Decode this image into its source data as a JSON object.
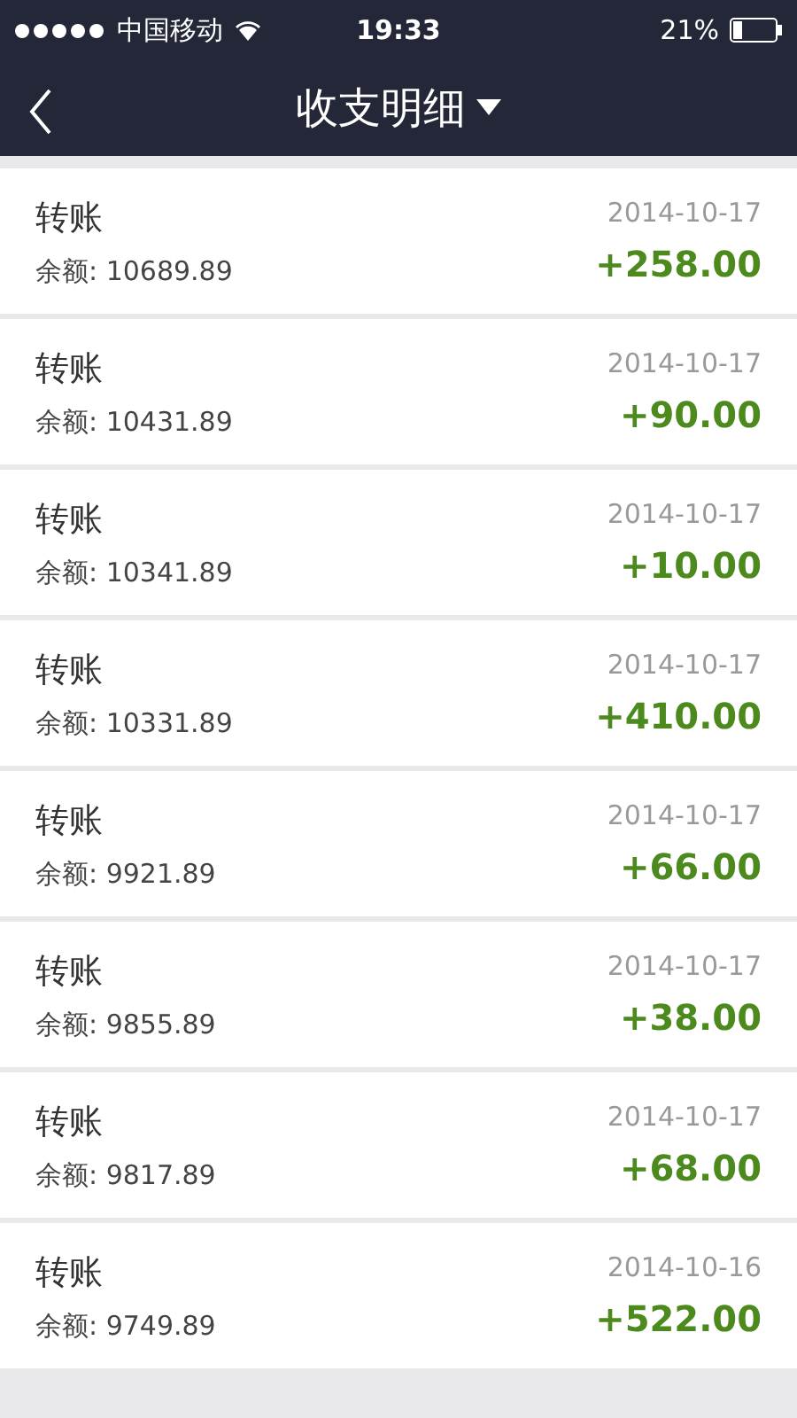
{
  "status_bar": {
    "carrier": "中国移动",
    "time": "19:33",
    "battery": "21%"
  },
  "nav": {
    "title": "收支明细"
  },
  "rows": [
    {
      "title": "转账",
      "balance": "余额: 10689.89",
      "date": "2014-10-17",
      "amount": "+258.00"
    },
    {
      "title": "转账",
      "balance": "余额: 10431.89",
      "date": "2014-10-17",
      "amount": "+90.00"
    },
    {
      "title": "转账",
      "balance": "余额: 10341.89",
      "date": "2014-10-17",
      "amount": "+10.00"
    },
    {
      "title": "转账",
      "balance": "余额: 10331.89",
      "date": "2014-10-17",
      "amount": "+410.00"
    },
    {
      "title": "转账",
      "balance": "余额: 9921.89",
      "date": "2014-10-17",
      "amount": "+66.00"
    },
    {
      "title": "转账",
      "balance": "余额: 9855.89",
      "date": "2014-10-17",
      "amount": "+38.00"
    },
    {
      "title": "转账",
      "balance": "余额: 9817.89",
      "date": "2014-10-17",
      "amount": "+68.00"
    },
    {
      "title": "转账",
      "balance": "余额: 9749.89",
      "date": "2014-10-16",
      "amount": "+522.00"
    }
  ]
}
